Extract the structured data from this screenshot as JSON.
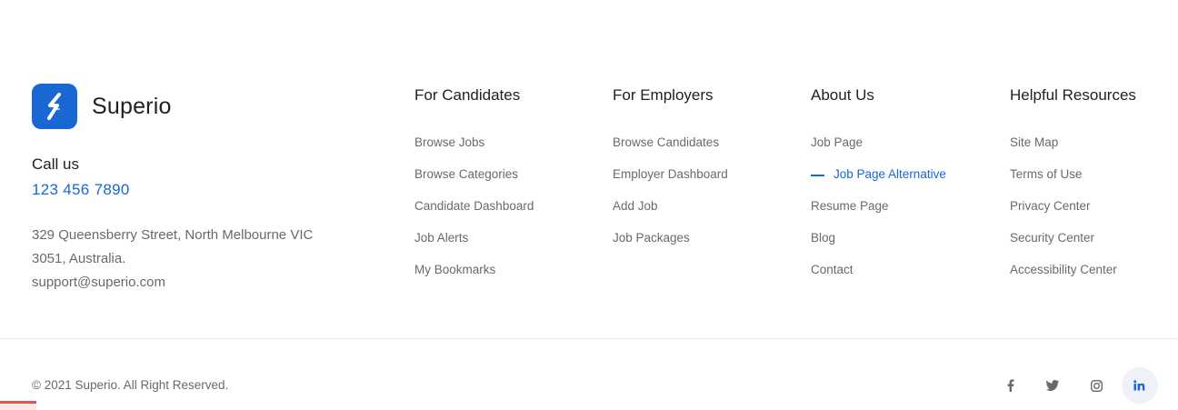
{
  "brand": {
    "name": "Superio",
    "logo_icon": "superio-s-logo-icon",
    "accent_color": "#1967d2"
  },
  "contact": {
    "call_label": "Call us",
    "phone": "123 456 7890",
    "address": "329 Queensberry Street, North Melbourne VIC 3051, Australia.",
    "email": "support@superio.com"
  },
  "columns": [
    {
      "title": "For Candidates",
      "links": [
        "Browse Jobs",
        "Browse Categories",
        "Candidate Dashboard",
        "Job Alerts",
        "My Bookmarks"
      ]
    },
    {
      "title": "For Employers",
      "links": [
        "Browse Candidates",
        "Employer Dashboard",
        "Add Job",
        "Job Packages"
      ]
    },
    {
      "title": "About Us",
      "links": [
        "Job Page",
        "Job Page Alternative",
        "Resume Page",
        "Blog",
        "Contact"
      ],
      "active_link": "Job Page Alternative"
    },
    {
      "title": "Helpful Resources",
      "links": [
        "Site Map",
        "Terms of Use",
        "Privacy Center",
        "Security Center",
        "Accessibility Center"
      ]
    }
  ],
  "bottom": {
    "copyright": "© 2021 Superio. All Right Reserved.",
    "social": [
      {
        "name": "facebook-icon",
        "glyph": "f"
      },
      {
        "name": "twitter-icon",
        "glyph": ""
      },
      {
        "name": "instagram-icon",
        "glyph": ""
      },
      {
        "name": "linkedin-icon",
        "glyph": "in"
      }
    ]
  }
}
